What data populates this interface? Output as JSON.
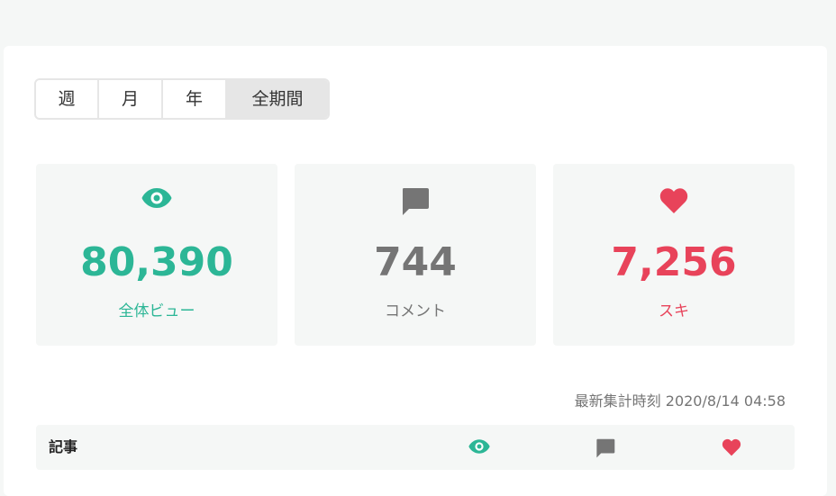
{
  "period_tabs": [
    {
      "label": "週"
    },
    {
      "label": "月"
    },
    {
      "label": "年"
    },
    {
      "label": "全期間",
      "selected": true
    }
  ],
  "stats": {
    "views": {
      "value": "80,390",
      "label": "全体ビュー",
      "color": "#2cb696",
      "icon": "eye-icon"
    },
    "comments": {
      "value": "744",
      "label": "コメント",
      "color": "#757575",
      "icon": "comment-icon"
    },
    "likes": {
      "value": "7,256",
      "label": "スキ",
      "color": "#e8435a",
      "icon": "heart-icon"
    }
  },
  "updated_at": "最新集計時刻 2020/8/14 04:58",
  "table": {
    "header_label": "記事",
    "header_icons": [
      "eye-icon",
      "comment-icon",
      "heart-icon"
    ]
  }
}
